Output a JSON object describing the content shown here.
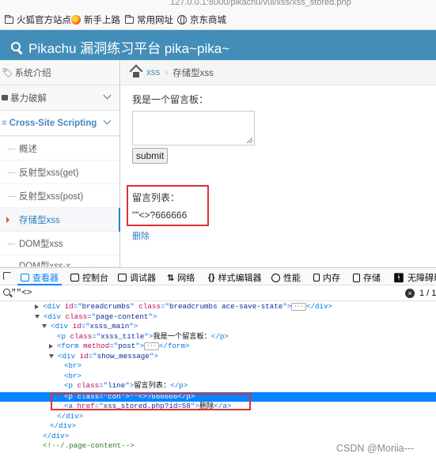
{
  "browser": {
    "url_fragment": "127.0.0.1:8000/pikachu/vul/xss/xss_stored.php",
    "bookmarks": [
      "火狐官方站点",
      "新手上路",
      "常用网址",
      "京东商城"
    ]
  },
  "app": {
    "title": "Pikachu 漏洞练习平台 pika~pika~",
    "header_color": "#438eb9"
  },
  "sidebar": {
    "items": [
      {
        "label": "系统介绍",
        "icon": "tag-icon"
      },
      {
        "label": "暴力破解",
        "icon": "lock-icon"
      },
      {
        "label": "Cross-Site Scripting",
        "icon": "list-icon"
      }
    ],
    "sub_items": [
      "概述",
      "反射型xss(get)",
      "反射型xss(post)",
      "存储型xss",
      "DOM型xss",
      "DOM型xss-x"
    ],
    "active_sub_index": 3
  },
  "breadcrumbs": {
    "link": "xss",
    "current": "存储型xss"
  },
  "message_board": {
    "title": "我是一个留言板：",
    "textarea_value": "",
    "submit_label": "submit",
    "list_title": "留言列表：",
    "items": [
      "\"\"<>?666666"
    ],
    "delete_label": "删除"
  },
  "devtools": {
    "tabs": [
      "查看器",
      "控制台",
      "调试器",
      "网络",
      "样式编辑器",
      "性能",
      "内存",
      "存储",
      "无障碍环境"
    ],
    "active_tab": 0,
    "search_value": "\"\"<>",
    "match_count": "1 / 1",
    "tree": [
      {
        "indent": 1,
        "toggle": "closed",
        "parts": [
          [
            "tag",
            "<div "
          ],
          [
            "attr",
            "id"
          ],
          [
            "tag",
            "=\""
          ],
          [
            "val",
            "breadcrumbs"
          ],
          [
            "tag",
            "\" "
          ],
          [
            "attr",
            "class"
          ],
          [
            "tag",
            "=\""
          ],
          [
            "val",
            "breadcrumbs ace-save-state"
          ],
          [
            "tag",
            "\">"
          ],
          [
            "ellip",
            "···"
          ],
          [
            "tag",
            "</div>"
          ]
        ]
      },
      {
        "indent": 1,
        "toggle": "open",
        "parts": [
          [
            "tag",
            "<div "
          ],
          [
            "attr",
            "class"
          ],
          [
            "tag",
            "=\""
          ],
          [
            "val",
            "page-content"
          ],
          [
            "tag",
            "\">"
          ]
        ]
      },
      {
        "indent": 2,
        "toggle": "open",
        "parts": [
          [
            "tag",
            "<div "
          ],
          [
            "attr",
            "id"
          ],
          [
            "tag",
            "=\""
          ],
          [
            "val",
            "xsss_main"
          ],
          [
            "tag",
            "\">"
          ]
        ]
      },
      {
        "indent": 3,
        "toggle": "",
        "parts": [
          [
            "tag",
            "<p "
          ],
          [
            "attr",
            "class"
          ],
          [
            "tag",
            "=\""
          ],
          [
            "val",
            "xsss_title"
          ],
          [
            "tag",
            "\">"
          ],
          [
            "txt",
            "我是一个留言板："
          ],
          [
            "tag",
            "</p>"
          ]
        ]
      },
      {
        "indent": 3,
        "toggle": "closed",
        "parts": [
          [
            "tag",
            "<form "
          ],
          [
            "attr",
            "method"
          ],
          [
            "tag",
            "=\""
          ],
          [
            "val",
            "post"
          ],
          [
            "tag",
            "\">"
          ],
          [
            "ellip",
            "···"
          ],
          [
            "tag",
            "</form>"
          ]
        ]
      },
      {
        "indent": 3,
        "toggle": "open",
        "parts": [
          [
            "tag",
            "<div "
          ],
          [
            "attr",
            "id"
          ],
          [
            "tag",
            "=\""
          ],
          [
            "val",
            "show_message"
          ],
          [
            "tag",
            "\">"
          ]
        ]
      },
      {
        "indent": 4,
        "toggle": "",
        "parts": [
          [
            "tag",
            "<br>"
          ]
        ]
      },
      {
        "indent": 4,
        "toggle": "",
        "parts": [
          [
            "tag",
            "<br>"
          ]
        ]
      },
      {
        "indent": 4,
        "toggle": "",
        "parts": [
          [
            "tag",
            "<p "
          ],
          [
            "attr",
            "class"
          ],
          [
            "tag",
            "=\""
          ],
          [
            "val",
            "line"
          ],
          [
            "tag",
            "\">"
          ],
          [
            "txt",
            "留言列表："
          ],
          [
            "tag",
            "</p>"
          ]
        ]
      },
      {
        "indent": 4,
        "toggle": "",
        "selected": true,
        "parts": [
          [
            "tag",
            "<p "
          ],
          [
            "attr",
            "class"
          ],
          [
            "tag",
            "=\""
          ],
          [
            "val",
            "con"
          ],
          [
            "tag",
            "\">"
          ],
          [
            "txt",
            "\"\"<>?666666"
          ],
          [
            "tag",
            "</p>"
          ]
        ]
      },
      {
        "indent": 4,
        "toggle": "",
        "parts": [
          [
            "tag",
            "<a "
          ],
          [
            "attr",
            "href"
          ],
          [
            "tag",
            "=\""
          ],
          [
            "val",
            "xss_stored.php?id=58"
          ],
          [
            "tag",
            "\">"
          ],
          [
            "txt",
            "删除"
          ],
          [
            "tag",
            "</a>"
          ]
        ]
      },
      {
        "indent": 3,
        "toggle": "",
        "parts": [
          [
            "tag",
            "</div>"
          ]
        ]
      },
      {
        "indent": 2,
        "toggle": "",
        "parts": [
          [
            "tag",
            "</div>"
          ]
        ]
      },
      {
        "indent": 1,
        "toggle": "",
        "parts": [
          [
            "tag",
            "</div>"
          ]
        ]
      },
      {
        "indent": 1,
        "toggle": "",
        "parts": [
          [
            "com",
            "<!--/.page-content-->"
          ]
        ]
      }
    ]
  },
  "watermark": "CSDN @Moriia---"
}
